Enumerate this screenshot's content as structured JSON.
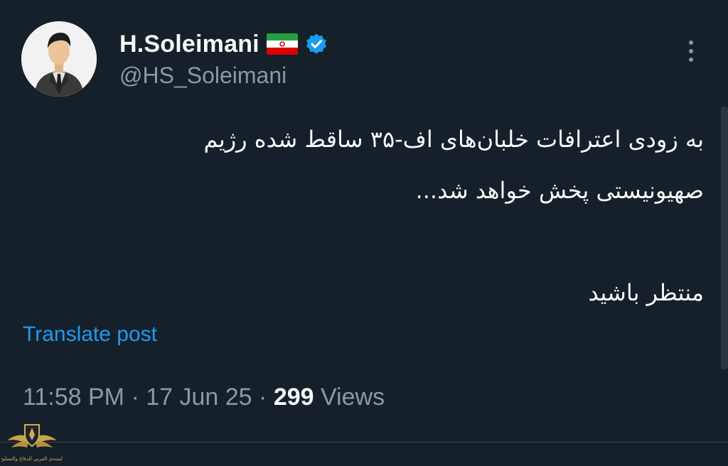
{
  "author": {
    "display_name": "H.Soleimani",
    "handle": "@HS_Soleimani"
  },
  "icons": {
    "flag": "iran-flag-icon",
    "verified": "verified-badge-icon",
    "more": "more-vertical-icon"
  },
  "tweet": {
    "lines": [
      "به زودی اعترافات خلبان‌های اف-۳۵ ساقط شده رژیم",
      "صهیونیستی پخش خواهد شد...",
      "منتظر باشید"
    ]
  },
  "translate_label": "Translate post",
  "meta": {
    "time": "11:58 PM",
    "separator": " · ",
    "date": "17 Jun 25",
    "views_count": "299",
    "views_label": " Views"
  },
  "watermark": {
    "text": "المنتدى العربي للدفاع والتسليح"
  },
  "colors": {
    "background": "#15202b",
    "text": "#f7f9f9",
    "secondary_text": "#8b98a5",
    "link": "#1d9bf0",
    "verified": "#1d9bf0",
    "divider": "#38444d"
  }
}
